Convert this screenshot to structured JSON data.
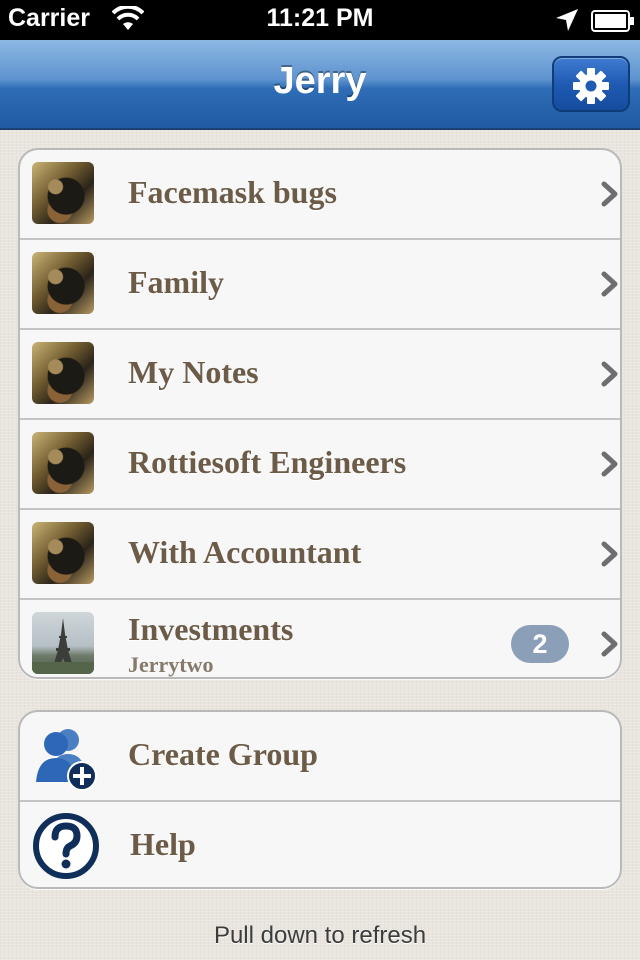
{
  "status_bar": {
    "carrier": "Carrier",
    "time": "11:21 PM",
    "icons": [
      "wifi-icon",
      "location-arrow-icon",
      "battery-icon"
    ]
  },
  "nav": {
    "title": "Jerry",
    "settings_icon": "gear-icon"
  },
  "groups": [
    {
      "label": "Facemask bugs",
      "avatar": "dog-photo"
    },
    {
      "label": "Family",
      "avatar": "dog-photo"
    },
    {
      "label": "My Notes",
      "avatar": "dog-photo"
    },
    {
      "label": "Rottiesoft Engineers",
      "avatar": "dog-photo"
    },
    {
      "label": "With Accountant",
      "avatar": "dog-photo"
    },
    {
      "label": "Investments",
      "sublabel": "Jerrytwo",
      "badge": "2",
      "avatar": "eiffel-tower-photo"
    }
  ],
  "actions": [
    {
      "label": "Create Group",
      "icon": "add-user-icon"
    },
    {
      "label": "Help",
      "icon": "question-icon"
    }
  ],
  "footer": {
    "hint": "Pull down to refresh"
  },
  "colors": {
    "nav_blue": "#1f5aa3",
    "label_brown": "#6b5b47",
    "badge_gray_blue": "#8c9fb9",
    "icon_navy": "#0f2f5a"
  }
}
